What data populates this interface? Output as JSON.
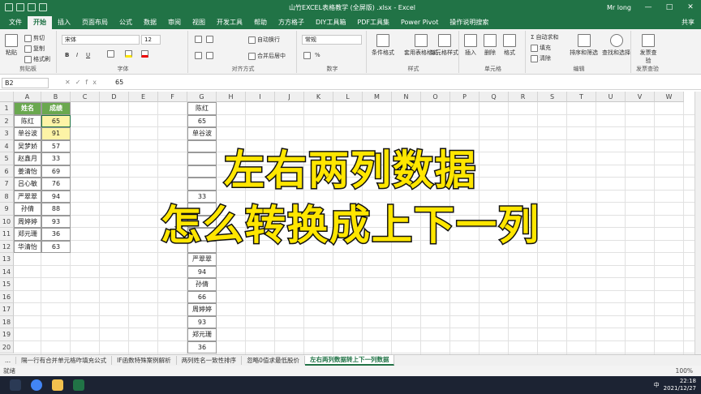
{
  "title_bar": {
    "doc_title": "山竹EXCEL表格教学 (全屏版) .xlsx - Excel",
    "user": "Mr long",
    "min": "—",
    "max": "□",
    "close": "✕"
  },
  "tabs": [
    "文件",
    "开始",
    "插入",
    "页面布局",
    "公式",
    "数据",
    "审阅",
    "视图",
    "开发工具",
    "帮助",
    "方方格子",
    "DIY工具箱",
    "PDF工具集",
    "Power Pivot",
    "操作说明搜索"
  ],
  "share": "共享",
  "ribbon": {
    "clipboard": {
      "paste": "粘贴",
      "cut": "剪切",
      "copy": "复制",
      "format_painter": "格式刷",
      "label": "剪贴板"
    },
    "font": {
      "font_name": "宋体",
      "font_size": "12",
      "label": "字体"
    },
    "alignment": {
      "wrap": "自动换行",
      "merge": "合并后居中",
      "label": "对齐方式"
    },
    "number": {
      "format": "常规",
      "label": "数字"
    },
    "styles": {
      "cond": "条件格式",
      "table": "套用表格格式",
      "cell_style": "单元格样式",
      "label": "样式"
    },
    "cells": {
      "insert": "插入",
      "delete": "删除",
      "format": "格式",
      "label": "单元格"
    },
    "editing": {
      "autosum": "自动求和",
      "fill": "填充",
      "clear": "清除",
      "sort": "排序和筛选",
      "find": "查找和选择",
      "label": "编辑"
    },
    "invoice": {
      "check": "发票查验",
      "label": "发票查验"
    }
  },
  "formula_bar": {
    "name_box": "B2",
    "value": "65"
  },
  "columns": [
    "A",
    "B",
    "C",
    "D",
    "E",
    "F",
    "G",
    "H",
    "I",
    "J",
    "K",
    "L",
    "M",
    "N",
    "O",
    "P",
    "Q",
    "R",
    "S",
    "T",
    "U",
    "V",
    "W"
  ],
  "rows": [
    "1",
    "2",
    "3",
    "4",
    "5",
    "6",
    "7",
    "8",
    "9",
    "10",
    "11",
    "12",
    "13",
    "14",
    "15",
    "16",
    "17",
    "18",
    "19",
    "20"
  ],
  "table": {
    "headers": [
      "姓名",
      "成绩"
    ],
    "rows": [
      [
        "陈红",
        "65"
      ],
      [
        "单谷波",
        "91"
      ],
      [
        "吴梦娇",
        "57"
      ],
      [
        "赵鑫月",
        "33"
      ],
      [
        "姜清怡",
        "69"
      ],
      [
        "吕心敏",
        "76"
      ],
      [
        "严翠翠",
        "94"
      ],
      [
        "孙倩",
        "88"
      ],
      [
        "周婷婷",
        "93"
      ],
      [
        "郑元珊",
        "36"
      ],
      [
        "华清怡",
        "63"
      ]
    ]
  },
  "col_g": [
    "陈红",
    "65",
    "单谷波",
    "",
    "",
    "",
    "",
    "33",
    "",
    "",
    "",
    "",
    "严翠翠",
    "94",
    "孙倩",
    "66",
    "周婷婷",
    "93",
    "郑元珊",
    "36"
  ],
  "overlay": {
    "line1": "左右两列数据",
    "line2": "怎么转换成上下一列"
  },
  "sheet_tabs": [
    "...",
    "隔一行有合并单元格咋填充公式",
    "IF函数特殊案例解析",
    "两列姓名一致性排序",
    "忽略0值求最低股价",
    "左右两列数据转上下一列数据"
  ],
  "status": {
    "ready": "就绪",
    "zoom": "100%"
  },
  "taskbar": {
    "time": "22:18",
    "date": "2021/12/27",
    "lang": "中"
  }
}
